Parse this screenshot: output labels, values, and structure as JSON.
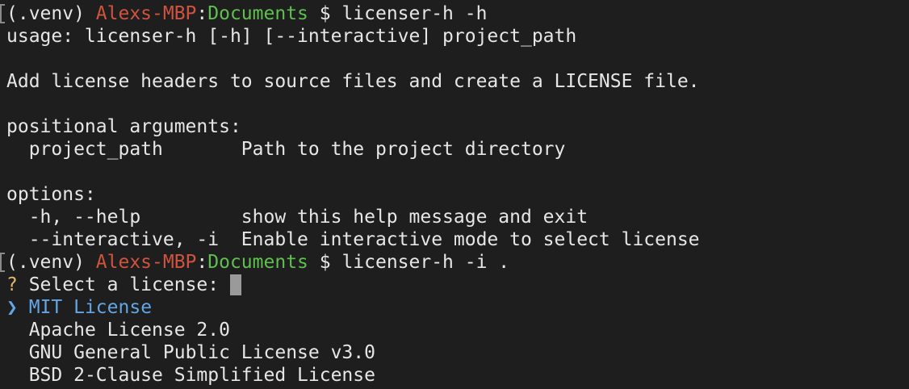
{
  "prompt": {
    "venv": "(.venv) ",
    "host": "Alexs-MBP",
    "sep": ":",
    "dir": "Documents",
    "dollar": " $ "
  },
  "commands": [
    "licenser-h -h",
    "licenser-h -i ."
  ],
  "help": {
    "usage": "usage: licenser-h [-h] [--interactive] project_path",
    "description": "Add license headers to source files and create a LICENSE file.",
    "positional_header": "positional arguments:",
    "positional": [
      {
        "name": "  project_path       ",
        "desc": "Path to the project directory"
      }
    ],
    "options_header": "options:",
    "options": [
      {
        "name": "  -h, --help         ",
        "desc": "show this help message and exit"
      },
      {
        "name": "  --interactive, -i  ",
        "desc": "Enable interactive mode to select license"
      }
    ]
  },
  "select": {
    "question_mark": "?",
    "question": " Select a license: ",
    "pointer": "❯",
    "options": [
      "MIT License",
      "Apache License 2.0",
      "GNU General Public License v3.0",
      "BSD 2-Clause Simplified License"
    ],
    "selected_index": 0
  },
  "colors": {
    "background": "#1e1e1e",
    "text": "#e6e6e6",
    "host": "#d0533f",
    "dir": "#5fbf4f",
    "question_mark": "#e0b86b",
    "selection": "#63a6e6"
  }
}
